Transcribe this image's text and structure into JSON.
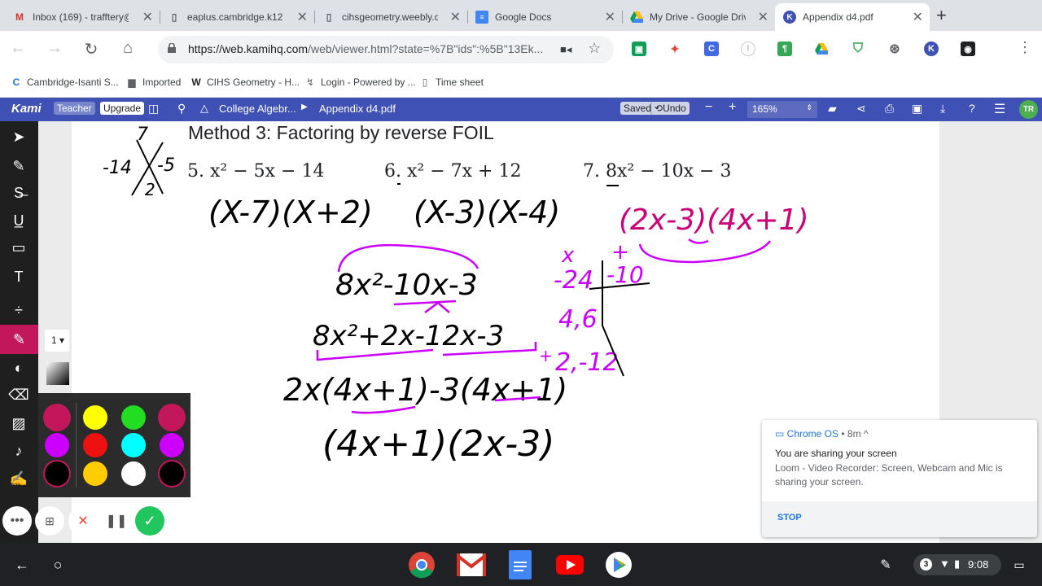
{
  "tabs": [
    {
      "title": "Inbox (169) - trafftery@",
      "favicon": "gmail-icon",
      "favicon_color": "#d93025"
    },
    {
      "title": "eaplus.cambridge.k12.",
      "favicon": "page-icon",
      "favicon_color": "#5f6368"
    },
    {
      "title": "cihsgeometry.weebly.c",
      "favicon": "page-icon",
      "favicon_color": "#5f6368"
    },
    {
      "title": "Google Docs",
      "favicon": "docs-icon",
      "favicon_color": "#4285f4"
    },
    {
      "title": "My Drive - Google Drive",
      "favicon": "drive-icon",
      "favicon_color": "#0f9d58"
    },
    {
      "title": "Appendix d4.pdf",
      "favicon": "kami-icon",
      "favicon_color": "#3f51b5"
    }
  ],
  "new_tab": "+",
  "address": {
    "host": "https://web.kamihq.com",
    "path": "/web/viewer.html?state=%7B\"ids\":%5B\"13Ek..."
  },
  "bookmarks": [
    {
      "label": "Cambridge-Isanti S...",
      "icon": "cambridge-icon"
    },
    {
      "label": "Imported",
      "icon": "folder-icon"
    },
    {
      "label": "CIHS Geometry - H...",
      "icon": "weebly-icon"
    },
    {
      "label": "Login - Powered by ...",
      "icon": "login-icon"
    },
    {
      "label": "Time sheet",
      "icon": "page-icon"
    }
  ],
  "kami": {
    "logo": "Kami",
    "teacher": "Teacher",
    "upgrade": "Upgrade",
    "crumb_folder": "College Algebr...",
    "crumb_file": "Appendix d4.pdf",
    "saved": "Saved",
    "undo": "Undo",
    "zoom": "165%",
    "avatar": "TR",
    "accent": "#3f51b5"
  },
  "document": {
    "heading": "Method 3: Factoring by reverse FOIL",
    "problems": [
      "5. x² − 5x − 14",
      "6. x² − 7x + 12",
      "7. 8x² − 10x − 3"
    ]
  },
  "handwriting": {
    "corner_top": "7",
    "corner_left": "-14",
    "corner_right": "-5",
    "corner_bottom": "2",
    "answer5": "(X-7)(X+2)",
    "answer6": "(X-3)(X-4)",
    "answer7": "(2x-3)(4x+1)",
    "step1": "8x²-10x-3",
    "step2": "8x²+2x-12x-3",
    "step3": "2x(4x+1)-3(4x+1)",
    "step4": "(4x+1)(2x-3)",
    "table_x": "x",
    "table_plus": "+",
    "table_product": "-24",
    "table_sum": "-10",
    "table_row1": "4,6",
    "table_row2": "2,-12",
    "table_marker": "+"
  },
  "pen": {
    "thickness": "1"
  },
  "palette": [
    "#c2185b",
    "#ffff00",
    "#22dd22",
    "#c2185b",
    "#cc00ff",
    "#ee1111",
    "#00ffff",
    "#cc00ff",
    "#000000",
    "#ffcc00",
    "#ffffff",
    "#000000"
  ],
  "notification": {
    "source": "Chrome OS",
    "meta": "• 8m ^",
    "title": "You are sharing your screen",
    "message": "Loom - Video Recorder: Screen, Webcam and Mic is sharing your screen.",
    "action": "STOP"
  },
  "tray": {
    "badge": "3",
    "time": "9:08"
  }
}
